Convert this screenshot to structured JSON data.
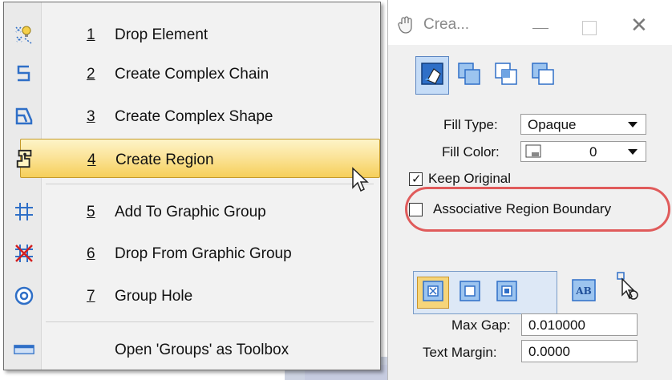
{
  "menu": {
    "items": [
      {
        "num": "1",
        "label": "Drop Element",
        "icon": "drop-element-icon"
      },
      {
        "num": "2",
        "label": "Create Complex Chain",
        "icon": "complex-chain-icon"
      },
      {
        "num": "3",
        "label": "Create Complex Shape",
        "icon": "complex-shape-icon"
      },
      {
        "num": "4",
        "label": "Create Region",
        "icon": "create-region-icon",
        "highlighted": true
      },
      {
        "num": "5",
        "label": "Add To Graphic Group",
        "icon": "graphic-group-icon"
      },
      {
        "num": "6",
        "label": "Drop From Graphic Group",
        "icon": "drop-graphic-group-icon"
      },
      {
        "num": "7",
        "label": "Group Hole",
        "icon": "group-hole-icon"
      }
    ],
    "open_as_toolbox": "Open 'Groups' as Toolbox"
  },
  "dialog": {
    "title": "Crea...",
    "fill_type_label": "Fill Type:",
    "fill_type_value": "Opaque",
    "fill_color_label": "Fill Color:",
    "fill_color_value": "0",
    "keep_original_label": "Keep Original",
    "keep_original_checked": true,
    "assoc_boundary_label": "Associative Region Boundary",
    "assoc_boundary_checked": false,
    "max_gap_label": "Max Gap:",
    "max_gap_value": "0.010000",
    "text_margin_label": "Text Margin:",
    "text_margin_value": "0.0000"
  },
  "colors": {
    "highlight": "#f6cf5a",
    "annotation": "#e05b5b",
    "icon_blue": "#2f6fc7"
  }
}
